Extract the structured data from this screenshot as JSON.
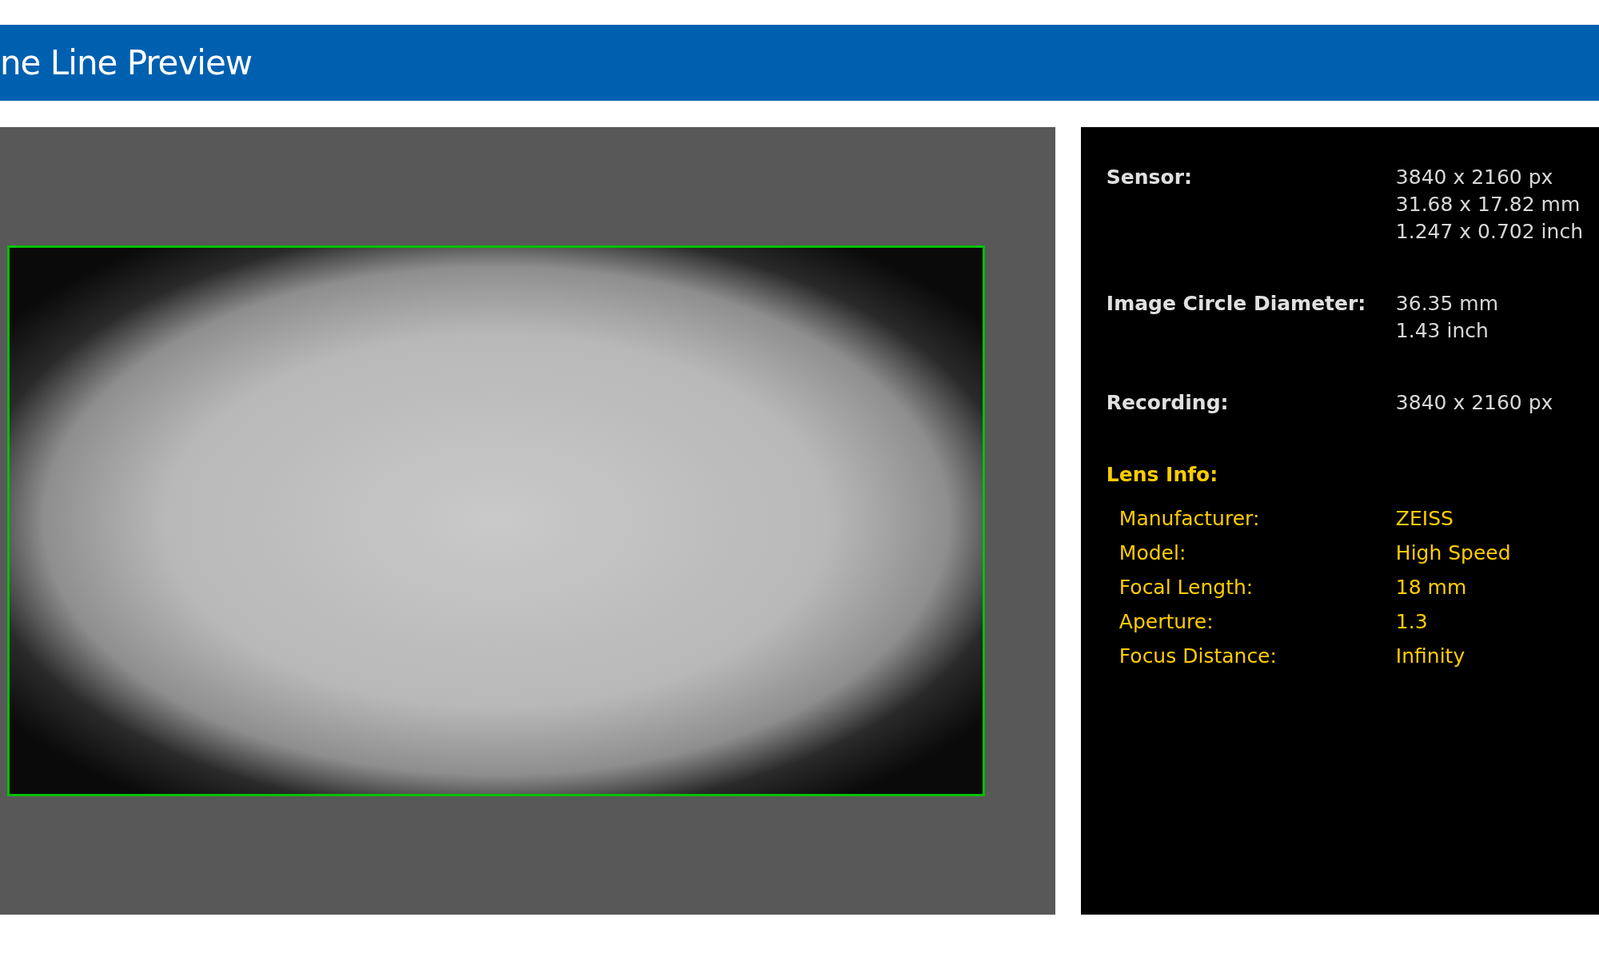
{
  "header": {
    "title": "ne Line Preview"
  },
  "specs": [
    {
      "label": "Sensor:",
      "values": [
        "3840 x 2160 px",
        "31.68 x 17.82 mm",
        "1.247 x 0.702 inch"
      ]
    },
    {
      "label": "Image Circle Diameter:",
      "values": [
        "36.35 mm",
        "1.43 inch"
      ]
    },
    {
      "label": "Recording:",
      "values": [
        "3840 x 2160 px"
      ]
    }
  ],
  "lens_info": {
    "title": "Lens Info:",
    "items": [
      {
        "label": "Manufacturer:",
        "value": "ZEISS"
      },
      {
        "label": "Model:",
        "value": "High Speed"
      },
      {
        "label": "Focal Length:",
        "value": "18 mm"
      },
      {
        "label": "Aperture:",
        "value": "1.3"
      },
      {
        "label": "Focus Distance:",
        "value": "Infinity"
      }
    ]
  }
}
